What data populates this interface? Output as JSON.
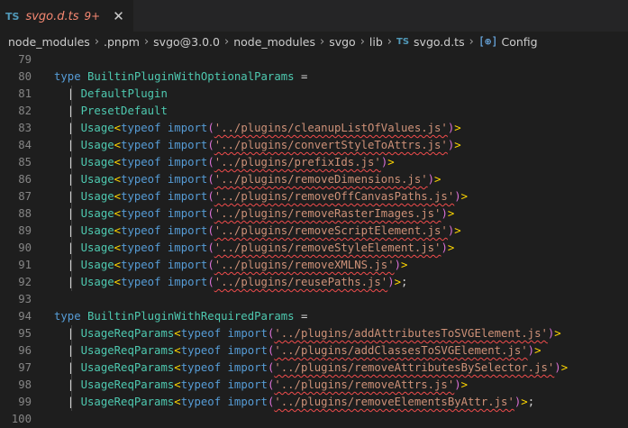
{
  "tab": {
    "badge": "TS",
    "filename": "svgo.d.ts",
    "problem_count": "9+",
    "close_glyph": "✕"
  },
  "breadcrumb": {
    "parts": [
      "node_modules",
      ".pnpm",
      "svgo@3.0.0",
      "node_modules",
      "svgo",
      "lib"
    ],
    "file_badge": "TS",
    "file": "svgo.d.ts",
    "symbol_glyph": "[⊕]",
    "symbol": "Config"
  },
  "code": {
    "lines": [
      {
        "n": "79",
        "kind": "blank"
      },
      {
        "n": "80",
        "kind": "decl",
        "keyword": "type",
        "name": "BuiltinPluginWithOptionalParams",
        "eq": " ="
      },
      {
        "n": "81",
        "kind": "union",
        "name": "DefaultPlugin"
      },
      {
        "n": "82",
        "kind": "union",
        "name": "PresetDefault"
      },
      {
        "n": "83",
        "kind": "usage",
        "wrap": "Usage",
        "path": "../plugins/cleanupListOfValues.js",
        "end": ""
      },
      {
        "n": "84",
        "kind": "usage",
        "wrap": "Usage",
        "path": "../plugins/convertStyleToAttrs.js",
        "end": ""
      },
      {
        "n": "85",
        "kind": "usage",
        "wrap": "Usage",
        "path": "../plugins/prefixIds.js",
        "end": ""
      },
      {
        "n": "86",
        "kind": "usage",
        "wrap": "Usage",
        "path": "../plugins/removeDimensions.js",
        "end": ""
      },
      {
        "n": "87",
        "kind": "usage",
        "wrap": "Usage",
        "path": "../plugins/removeOffCanvasPaths.js",
        "end": ""
      },
      {
        "n": "88",
        "kind": "usage",
        "wrap": "Usage",
        "path": "../plugins/removeRasterImages.js",
        "end": ""
      },
      {
        "n": "89",
        "kind": "usage",
        "wrap": "Usage",
        "path": "../plugins/removeScriptElement.js",
        "end": ""
      },
      {
        "n": "90",
        "kind": "usage",
        "wrap": "Usage",
        "path": "../plugins/removeStyleElement.js",
        "end": ""
      },
      {
        "n": "91",
        "kind": "usage",
        "wrap": "Usage",
        "path": "../plugins/removeXMLNS.js",
        "end": ""
      },
      {
        "n": "92",
        "kind": "usage",
        "wrap": "Usage",
        "path": "../plugins/reusePaths.js",
        "end": ";"
      },
      {
        "n": "93",
        "kind": "blank"
      },
      {
        "n": "94",
        "kind": "decl",
        "keyword": "type",
        "name": "BuiltinPluginWithRequiredParams",
        "eq": " ="
      },
      {
        "n": "95",
        "kind": "usage",
        "wrap": "UsageReqParams",
        "path": "../plugins/addAttributesToSVGElement.js",
        "end": ""
      },
      {
        "n": "96",
        "kind": "usage",
        "wrap": "UsageReqParams",
        "path": "../plugins/addClassesToSVGElement.js",
        "end": ""
      },
      {
        "n": "97",
        "kind": "usage",
        "wrap": "UsageReqParams",
        "path": "../plugins/removeAttributesBySelector.js",
        "end": ""
      },
      {
        "n": "98",
        "kind": "usage",
        "wrap": "UsageReqParams",
        "path": "../plugins/removeAttrs.js",
        "end": ""
      },
      {
        "n": "99",
        "kind": "usage",
        "wrap": "UsageReqParams",
        "path": "../plugins/removeElementsByAttr.js",
        "end": ";"
      },
      {
        "n": "100",
        "kind": "blank"
      }
    ],
    "typeof_kw": "typeof",
    "import_kw": "import"
  },
  "colors": {
    "background": "#1e1e1e",
    "keyword": "#569cd6",
    "type": "#4ec9b0",
    "string": "#ce9178",
    "error_squiggle": "#f14c4c",
    "tab_error_text": "#f48771"
  }
}
